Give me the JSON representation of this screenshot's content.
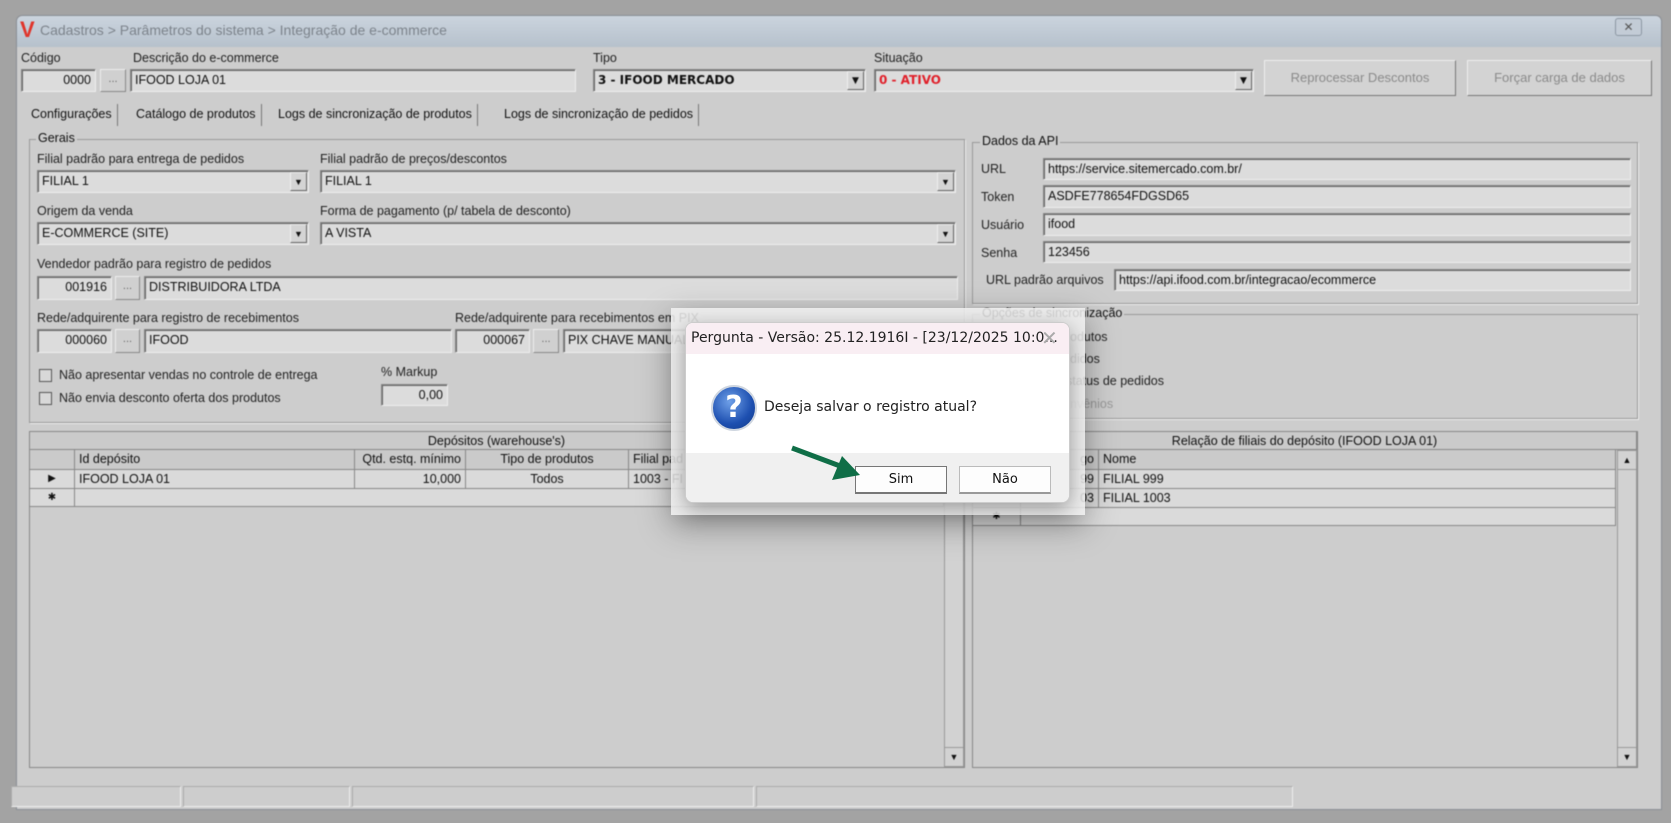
{
  "window": {
    "title": "Cadastros > Parâmetros do sistema > Integração de e-commerce",
    "logo": "V",
    "close_icon": "close-icon"
  },
  "header": {
    "codigo_label": "Código",
    "codigo_value": "0000",
    "lookup": "...",
    "descricao_label": "Descrição do e-commerce",
    "descricao_value": "IFOOD LOJA 01",
    "tipo_label": "Tipo",
    "tipo_value": "3 - IFOOD MERCADO",
    "situacao_label": "Situação",
    "situacao_value": "0 - ATIVO",
    "situacao_color": "#e0202a",
    "reprocessar": "Reprocessar Descontos",
    "forcar": "Forçar carga de dados"
  },
  "tabs": [
    "Configurações",
    "Catálogo de produtos",
    "Logs de sincronização de produtos",
    "Logs de sincronização de pedidos"
  ],
  "gerais": {
    "title": "Gerais",
    "filial_entrega_label": "Filial padrão para entrega de pedidos",
    "filial_entrega": "FILIAL 1",
    "filial_precos_label": "Filial padrão de preços/descontos",
    "filial_precos": "FILIAL 1",
    "origem_label": "Origem da venda",
    "origem": "E-COMMERCE (SITE)",
    "forma_label": "Forma de pagamento (p/ tabela de desconto)",
    "forma": "A VISTA",
    "vendedor_label": "Vendedor padrão para registro de pedidos",
    "vendedor_code": "001916",
    "vendedor_name": "DISTRIBUIDORA LTDA",
    "rede_label": "Rede/adquirente para registro de recebimentos",
    "rede_code": "000060",
    "rede_name": "IFOOD",
    "rede_pix_label": "Rede/adquirente para recebimentos em PIX",
    "rede_pix_code": "000067",
    "rede_pix_name": "PIX CHAVE MANUAL",
    "chk1": "Não apresentar vendas no controle de entrega",
    "chk2": "Não envia desconto oferta dos produtos",
    "markup_label": "% Markup",
    "markup": "0,00"
  },
  "api": {
    "title": "Dados da API",
    "url_label": "URL",
    "url": "https://service.sitemercado.com.br/",
    "token_label": "Token",
    "token": "ASDFE778654FDGSD65",
    "usuario_label": "Usuário",
    "usuario": "ifood",
    "senha_label": "Senha",
    "senha": "123456",
    "url_arq_label": "URL padrão arquivos",
    "url_arq": "https://api.ifood.com.br/integracao/ecommerce"
  },
  "sync": {
    "title": "Opções de sincronização",
    "items": [
      "odutos",
      "didos",
      "status de pedidos",
      "nvênios"
    ]
  },
  "depositos": {
    "title": "Depósitos (warehouse's)",
    "columns": [
      "Id depósito",
      "Qtd. estq. mínimo",
      "Tipo de produtos",
      "Filial pad"
    ],
    "rows": [
      {
        "indicator": "▶",
        "id": "IFOOD LOJA 01",
        "qtd": "10,000",
        "tipo": "Todos",
        "filial": "1003 - FI"
      }
    ],
    "new_row": "✱"
  },
  "filiais": {
    "title": "Relação de filiais do depósito (IFOOD LOJA 01)",
    "columns": [
      "go",
      "Nome"
    ],
    "rows": [
      {
        "code": "99",
        "nome": "FILIAL 999"
      },
      {
        "code": "03",
        "nome": "FILIAL 1003"
      }
    ],
    "new_row": "✱"
  },
  "dialog": {
    "title": "Pergunta - Versão: 25.12.1916I - [23/12/2025 10:0...",
    "message": "Deseja salvar o registro atual?",
    "icon": "?",
    "yes": "Sim",
    "no": "Não",
    "arrow_color": "#0f6e47"
  }
}
